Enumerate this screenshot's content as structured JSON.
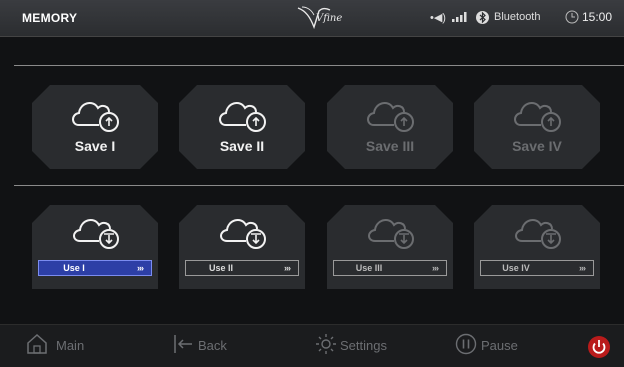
{
  "header": {
    "title": "MEMORY",
    "logo_text": "Vfine",
    "audio_icon": "volume-icon",
    "signal_icon": "signal-bars-icon",
    "bluetooth_label": "Bluetooth",
    "time": "15:00"
  },
  "save_slots": [
    {
      "label": "Save I",
      "state": "active"
    },
    {
      "label": "Save II",
      "state": "active"
    },
    {
      "label": "Save III",
      "state": "disabled"
    },
    {
      "label": "Save IV",
      "state": "disabled"
    }
  ],
  "use_slots": [
    {
      "label": "Use I",
      "arrows": "›››",
      "selected": true
    },
    {
      "label": "Use II",
      "arrows": "›››",
      "selected": false
    },
    {
      "label": "Use III",
      "arrows": "›››",
      "selected": false
    },
    {
      "label": "Use IV",
      "arrows": "›››",
      "selected": false
    }
  ],
  "footer": {
    "main": "Main",
    "back": "Back",
    "settings": "Settings",
    "pause": "Pause"
  },
  "colors": {
    "selected_bar": "#2d3fa6",
    "power": "#b91b1b"
  }
}
